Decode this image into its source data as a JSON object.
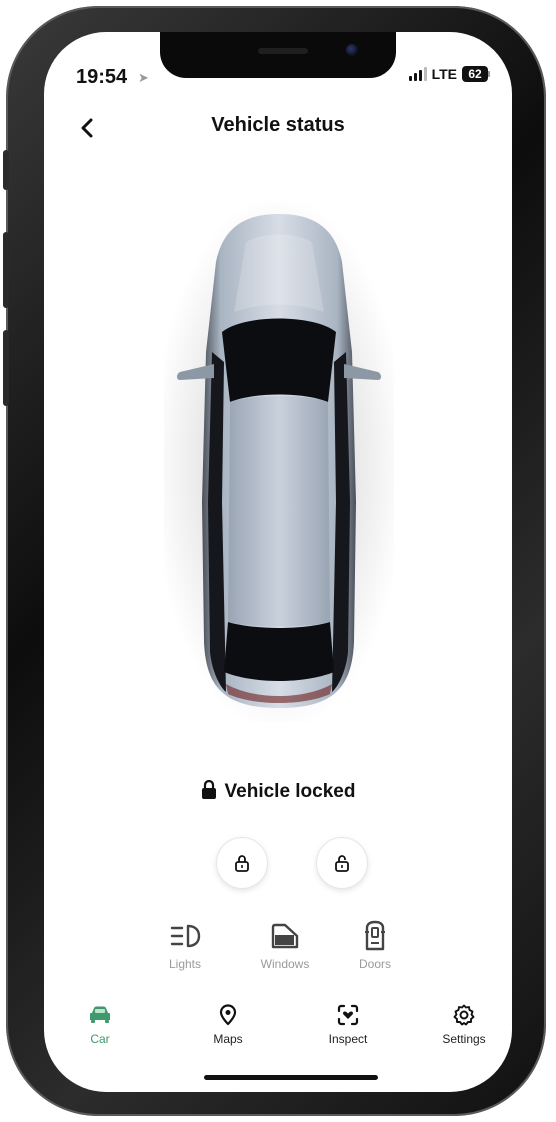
{
  "status_bar": {
    "time": "19:54",
    "network": "LTE",
    "battery": "62"
  },
  "header": {
    "back_icon": "chevron-left-icon",
    "title": "Vehicle status"
  },
  "vehicle": {
    "lock_status": "Vehicle locked",
    "lock_icon": "padlock-icon"
  },
  "lock_controls": [
    {
      "icon": "lock-icon"
    },
    {
      "icon": "unlock-icon"
    }
  ],
  "features": [
    {
      "label": "Lights",
      "icon": "headlights-icon"
    },
    {
      "label": "Windows",
      "icon": "window-icon"
    },
    {
      "label": "Doors",
      "icon": "door-icon"
    }
  ],
  "nav": {
    "items": [
      {
        "label": "Car",
        "icon": "car-icon",
        "active": true
      },
      {
        "label": "Maps",
        "icon": "map-pin-icon",
        "active": false
      },
      {
        "label": "Inspect",
        "icon": "inspect-icon",
        "active": false
      },
      {
        "label": "Settings",
        "icon": "gear-icon",
        "active": false
      }
    ]
  },
  "colors": {
    "accent": "#3e9a6a",
    "text": "#111111",
    "muted": "#9a9a9a",
    "background": "#ffffff"
  }
}
